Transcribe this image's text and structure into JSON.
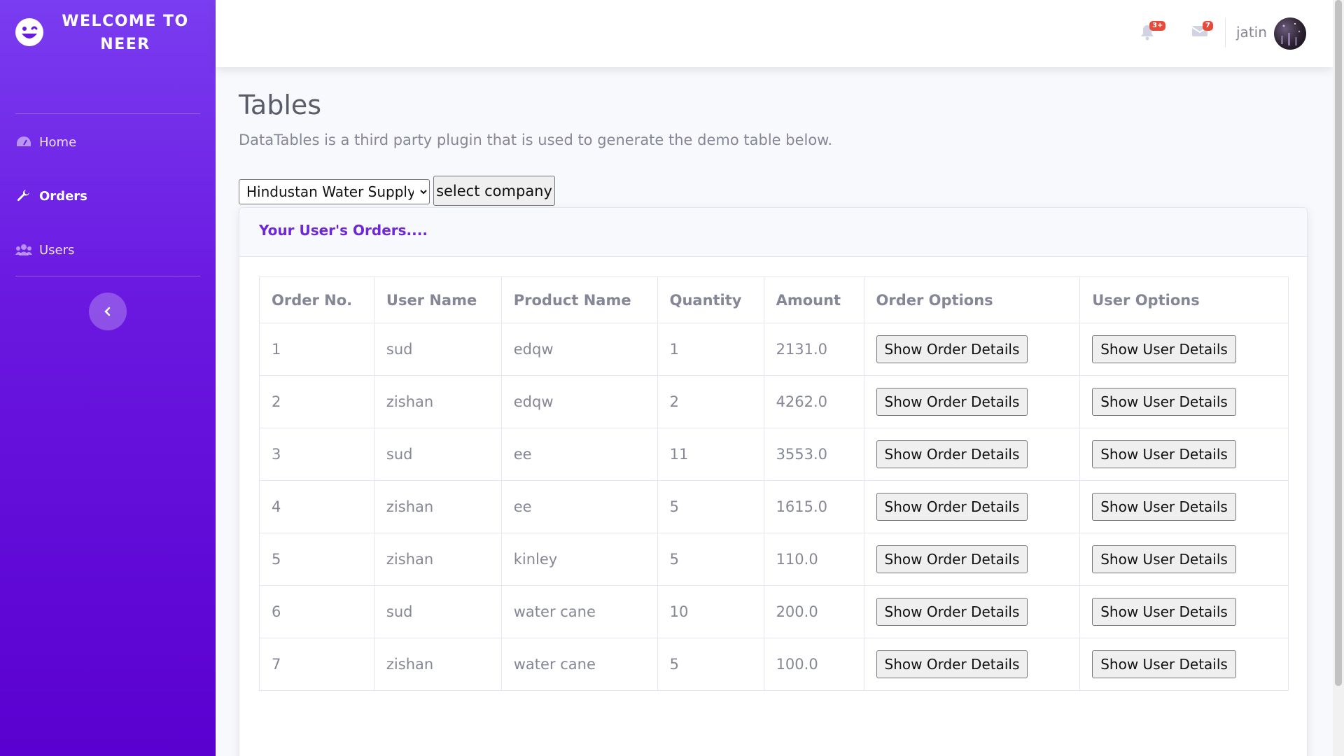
{
  "sidebar": {
    "brand_line1": "WELCOME TO",
    "brand_line2": "NEER",
    "items": [
      {
        "label": "Home",
        "icon": "tachometer-icon"
      },
      {
        "label": "Orders",
        "icon": "wrench-icon",
        "active": true
      },
      {
        "label": "Users",
        "icon": "users-icon"
      }
    ],
    "toggle_icon": "chevron-left-icon"
  },
  "topbar": {
    "alerts_badge": "3+",
    "messages_badge": "7",
    "username": "jatin"
  },
  "main": {
    "title": "Tables",
    "description": "DataTables is a third party plugin that is used to generate the demo table below.",
    "company_selected": "Hindustan Water Supply",
    "select_button": "select company",
    "card_title": "Your User's Orders...."
  },
  "table": {
    "headers": [
      "Order No.",
      "User Name",
      "Product Name",
      "Quantity",
      "Amount",
      "Order Options",
      "User Options"
    ],
    "order_button": "Show Order Details",
    "user_button": "Show User Details",
    "rows": [
      {
        "no": "1",
        "user": "sud",
        "product": "edqw",
        "qty": "1",
        "amount": "2131.0"
      },
      {
        "no": "2",
        "user": "zishan",
        "product": "edqw",
        "qty": "2",
        "amount": "4262.0"
      },
      {
        "no": "3",
        "user": "sud",
        "product": "ee",
        "qty": "11",
        "amount": "3553.0"
      },
      {
        "no": "4",
        "user": "zishan",
        "product": "ee",
        "qty": "5",
        "amount": "1615.0"
      },
      {
        "no": "5",
        "user": "zishan",
        "product": "kinley",
        "qty": "5",
        "amount": "110.0"
      },
      {
        "no": "6",
        "user": "sud",
        "product": "water cane",
        "qty": "10",
        "amount": "200.0"
      },
      {
        "no": "7",
        "user": "zishan",
        "product": "water cane",
        "qty": "5",
        "amount": "100.0"
      }
    ]
  },
  "colors": {
    "sidebar_top": "#7a3df0",
    "sidebar_bottom": "#5a00d0",
    "accent": "#6f28d8",
    "badge": "#e74a3b"
  }
}
